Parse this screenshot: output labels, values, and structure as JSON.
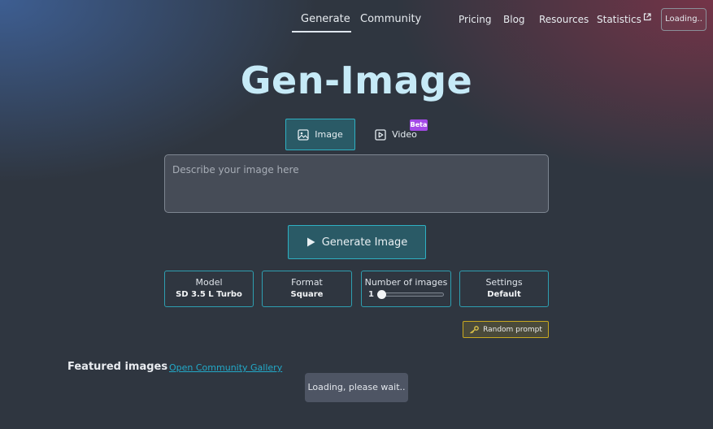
{
  "nav": {
    "generate": "Generate",
    "community": "Community",
    "pricing": "Pricing",
    "blog": "Blog",
    "resources": "Resources",
    "statistics": "Statistics",
    "statistics_icon": "external-link-icon",
    "loading_button": "Loading.."
  },
  "title": "Gen-Image",
  "modes": {
    "image": "Image",
    "image_icon": "image-icon",
    "video": "Video",
    "video_icon": "play-square-icon",
    "beta_badge": "Beta"
  },
  "prompt": {
    "placeholder": "Describe your image here",
    "value": ""
  },
  "generate_button": {
    "label": "Generate Image",
    "icon": "play-icon"
  },
  "options": {
    "model": {
      "label": "Model",
      "value": "SD 3.5 L Turbo"
    },
    "format": {
      "label": "Format",
      "value": "Square"
    },
    "num_images": {
      "label": "Number of images",
      "value": "1",
      "level": 0
    },
    "settings": {
      "label": "Settings",
      "value": "Default"
    }
  },
  "random_prompt": {
    "label": "Random prompt",
    "icon": "key-icon"
  },
  "featured": {
    "title": "Featured images",
    "gallery_link": "Open Community Gallery",
    "loading": "Loading, please wait.."
  },
  "colors": {
    "accent": "#2eb0c2",
    "title": "#c6eaf7",
    "beta": "#a349e6",
    "random_border": "#c9a91f",
    "link": "#22a9c8"
  }
}
